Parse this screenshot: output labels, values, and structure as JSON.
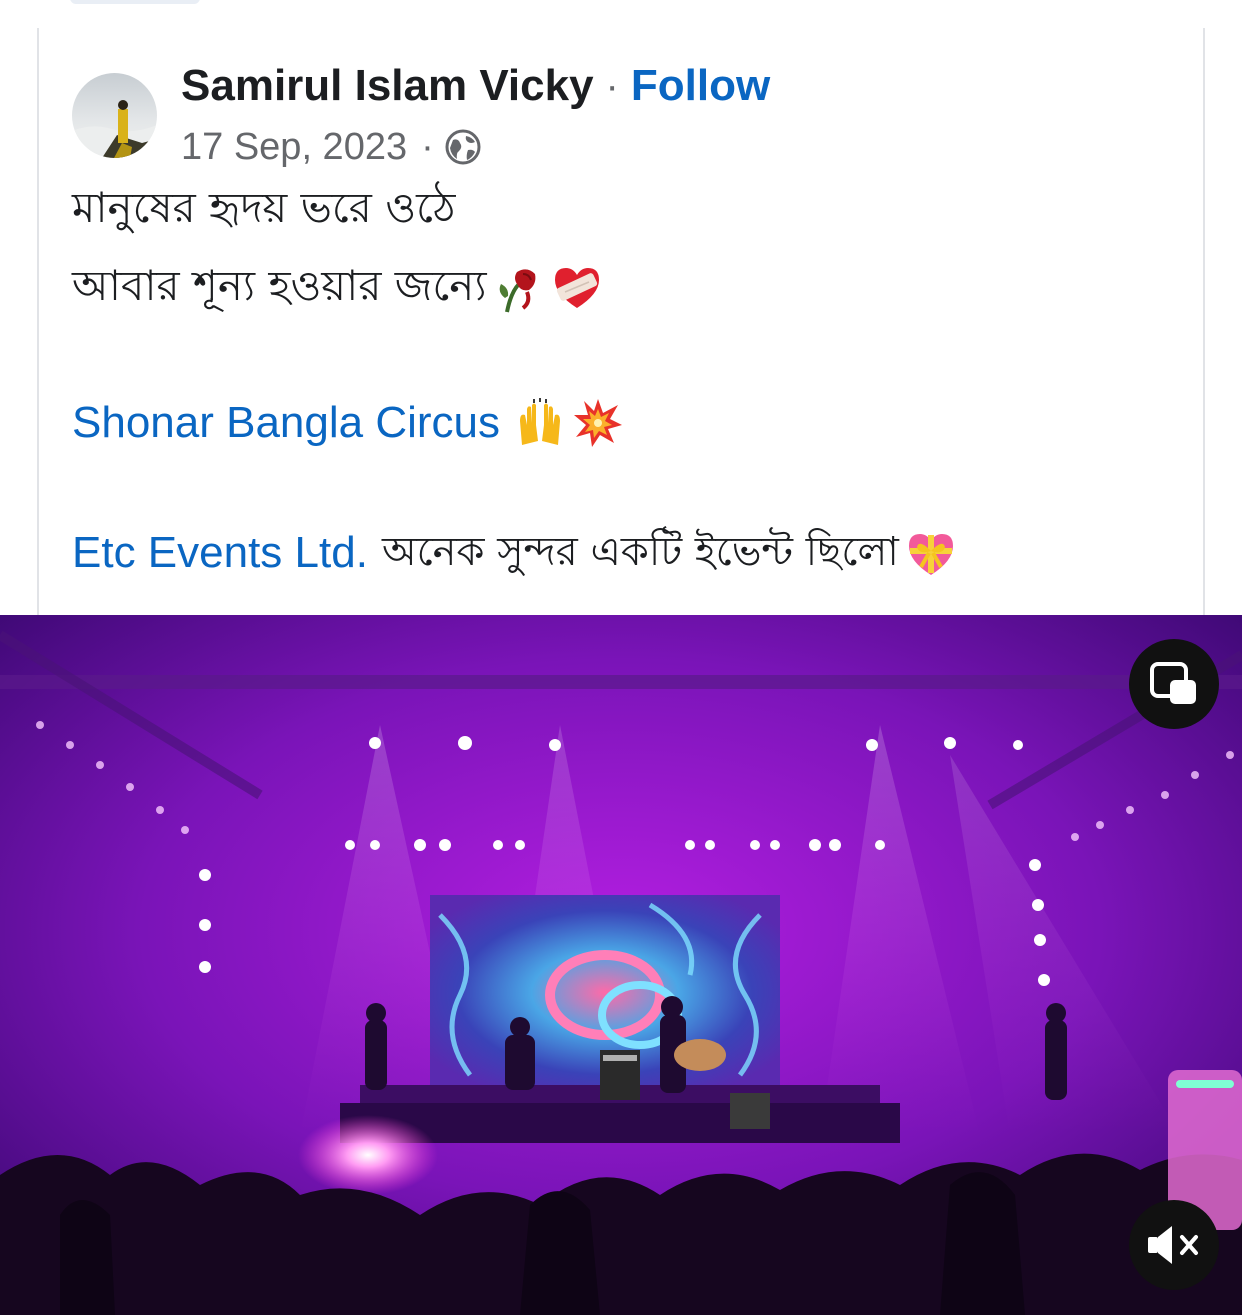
{
  "post": {
    "author": {
      "name": "Samirul Islam Vicky",
      "separator": "·",
      "follow_label": "Follow",
      "avatar_icon": "profile-photo-avatar"
    },
    "meta": {
      "date": "17 Sep, 2023",
      "separator": "·",
      "privacy_icon": "globe-icon"
    },
    "text": {
      "line1": "মানুষের হৃদয় ভরে ওঠে",
      "line2": "আবার শূন্য হওয়ার জন্যে",
      "line2_emojis": [
        "wilted-rose-emoji",
        "mending-heart-emoji"
      ],
      "tag1": "Shonar Bangla Circus",
      "tag1_emojis": [
        "raising-hands-emoji",
        "collision-emoji"
      ],
      "tag2": "Etc Events Ltd.",
      "tag2_text": "অনেক সুন্দর একটি ইভেন্ট ছিলো",
      "tag2_emojis": [
        "heart-with-ribbon-emoji"
      ]
    },
    "colors": {
      "link": "#0a66c2",
      "text": "#1c1e21",
      "secondary": "#65676b",
      "video_glow": "#b21ee0"
    }
  },
  "video": {
    "scene": "concert-stage-video-frame",
    "controls": {
      "pip_icon": "picture-in-picture-icon",
      "mute_icon": "speaker-muted-icon"
    }
  }
}
